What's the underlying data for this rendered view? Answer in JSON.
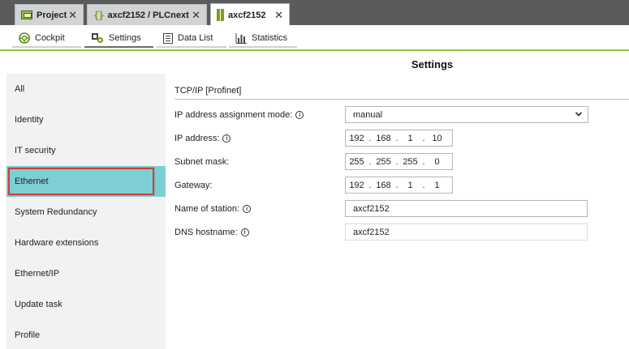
{
  "doc_tabs": [
    {
      "label": "Project",
      "icon": "project-folder-icon",
      "active": false
    },
    {
      "label": "axcf2152 / PLCnext",
      "icon": "plcnext-braces-icon",
      "active": false
    },
    {
      "label": "axcf2152",
      "icon": "device-icon",
      "active": true
    }
  ],
  "close_glyph": "✕",
  "view_tabs": [
    {
      "label": "Cockpit",
      "icon": "cockpit-gauge-icon"
    },
    {
      "label": "Settings",
      "icon": "settings-gears-icon",
      "active": true
    },
    {
      "label": "Data List",
      "icon": "data-list-icon"
    },
    {
      "label": "Statistics",
      "icon": "statistics-chart-icon"
    }
  ],
  "page_title": "Settings",
  "sidebar": {
    "items": [
      {
        "label": "All"
      },
      {
        "label": "Identity"
      },
      {
        "label": "IT security"
      },
      {
        "label": "Ethernet",
        "active": true
      },
      {
        "label": "System Redundancy"
      },
      {
        "label": "Hardware extensions"
      },
      {
        "label": "Ethernet/IP"
      },
      {
        "label": "Update task"
      },
      {
        "label": "Profile"
      }
    ]
  },
  "form": {
    "section_title": "TCP/IP [Profinet]",
    "assignment_mode": {
      "label": "IP address assignment mode:",
      "value": "manual"
    },
    "ip_address": {
      "label": "IP address:",
      "octets": [
        "192",
        "168",
        "1",
        "10"
      ]
    },
    "subnet_mask": {
      "label": "Subnet mask:",
      "octets": [
        "255",
        "255",
        "255",
        "0"
      ]
    },
    "gateway": {
      "label": "Gateway:",
      "octets": [
        "192",
        "168",
        "1",
        "1"
      ]
    },
    "station_name": {
      "label": "Name of station:",
      "value": "axcf2152"
    },
    "dns_hostname": {
      "label": "DNS hostname:",
      "value": "axcf2152"
    },
    "info_glyph": "i",
    "ip_separator": "."
  },
  "colors": {
    "accent_green": "#8dc63f",
    "selected_item": "#7ecfd4",
    "highlight_border": "#d23b35",
    "tabbar_bg": "#595b5d"
  }
}
